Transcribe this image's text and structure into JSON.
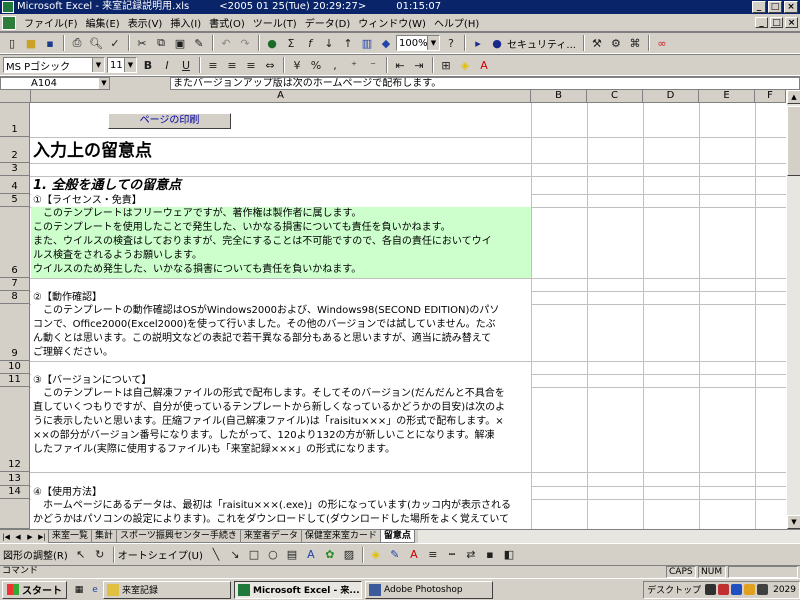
{
  "window": {
    "title": "Microsoft Excel - 来室記録説明用.xls　　　<2005 01 25(Tue) 20:29:27>　　　01:15:07",
    "min": "_",
    "max": "□",
    "close": "×"
  },
  "menu": {
    "items": [
      "ファイル(F)",
      "編集(E)",
      "表示(V)",
      "挿入(I)",
      "書式(O)",
      "ツール(T)",
      "データ(D)",
      "ウィンドウ(W)",
      "ヘルプ(H)"
    ]
  },
  "toolbar": {
    "zoom": "100%",
    "security": "セキュリティ..."
  },
  "format": {
    "font": "MS Pゴシック",
    "size": "11",
    "bold": "B",
    "italic": "I",
    "underline": "U"
  },
  "formula": {
    "cell_ref": "A104",
    "content": "またバージョンアップ版は次のホームページで配布します。"
  },
  "grid": {
    "columns": [
      "A",
      "B",
      "C",
      "D",
      "E",
      "F"
    ],
    "rows": [
      "1",
      "2",
      "3",
      "4",
      "5",
      "6",
      "7",
      "8",
      "9",
      "10",
      "11",
      "12",
      "13",
      "14"
    ],
    "print_button": "ページの印刷",
    "r2": "入力上の留意点",
    "r4": "1. 全般を通しての留意点",
    "r5": "①【ライセンス・免責】",
    "r6": [
      "　このテンプレートはフリーウェアですが、著作権は製作者に属します。",
      "このテンプレートを使用したことで発生した、いかなる損害についても責任を負いかねます。",
      "また、ウイルスの検査はしておりますが、完全にすることは不可能ですので、各自の責任においてウイ",
      "ルス検査をされるようお願いします。",
      "ウイルスのため発生した、いかなる損害についても責任を負いかねます。"
    ],
    "r8": "②【動作確認】",
    "r9": [
      "　このテンプレートの動作確認はOSがWindows2000および、Windows98(SECOND EDITION)のパソ",
      "コンで、Office2000(Excel2000)を使って行いました。その他のバージョンでは試していません。たぶ",
      "ん動くとは思います。この説明文などの表記で若干異なる部分もあると思いますが、適当に読み替えて",
      "ご理解ください。"
    ],
    "r11": "③【バージョンについて】",
    "r12": [
      "　このテンプレートは自己解凍ファイルの形式で配布します。そしてそのバージョン(だんだんと不具合を",
      "直していくつもりですが、自分が使っているテンプレートから新しくなっているかどうかの目安)は次のよ",
      "うに表示したいと思います。圧縮ファイル(自己解凍ファイル)は「raisitu×××」の形式で配布します。×",
      "××の部分がバージョン番号になります。したがって、120より132の方が新しいことになります。解凍",
      "したファイル(実際に使用するファイル)も「来室記録×××」の形式になります。"
    ],
    "r14": "④【使用方法】",
    "r15": [
      "　ホームページにあるデータは、最初は「raisitu×××(.exe)」の形になっています(カッコ内が表示される",
      "かどうかはパソコンの設定によります)。これをダウンロードして(ダウンロードした場所をよく覚えていて"
    ]
  },
  "sheets": {
    "tabs": [
      "来室一覧",
      "集計",
      "スポーツ振興センター手続き",
      "来室者データ",
      "保健室来室カード",
      "留意点"
    ],
    "active": "留意点"
  },
  "drawing": {
    "adjust": "図形の調整(R)",
    "autoshape": "オートシェイプ(U)"
  },
  "status": {
    "left": "コマンド",
    "caps": "CAPS",
    "num": "NUM"
  },
  "taskbar": {
    "start": "スタート",
    "items": [
      "来室記録",
      "Microsoft Excel - 来...",
      "Adobe Photoshop"
    ],
    "desktop": "デスクトップ",
    "clock": "2029"
  },
  "colors": {
    "title_bg": "#0a246a",
    "note_bg": "#ccffcc",
    "face": "#d4d0c8"
  }
}
